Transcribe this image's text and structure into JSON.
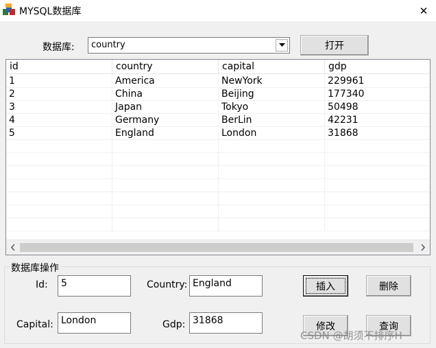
{
  "window": {
    "title": "MYSQL数据库",
    "close_glyph": "✕"
  },
  "toolbar": {
    "db_label": "数据库:",
    "db_selected": "country",
    "open_button": "打开"
  },
  "table": {
    "columns": [
      "id",
      "country",
      "capital",
      "gdp"
    ],
    "rows": [
      [
        "1",
        "America",
        "NewYork",
        "229961"
      ],
      [
        "2",
        "China",
        "Beijing",
        "177340"
      ],
      [
        "3",
        "Japan",
        "Tokyo",
        "50498"
      ],
      [
        "4",
        "Germany",
        "BerLin",
        "42231"
      ],
      [
        "5",
        "England",
        "London",
        "31868"
      ]
    ]
  },
  "form": {
    "group_title": "数据库操作",
    "id_label": "Id:",
    "id_value": "5",
    "country_label": "Country:",
    "country_value": "England",
    "capital_label": "Capital:",
    "capital_value": "London",
    "gdp_label": "Gdp:",
    "gdp_value": "31868",
    "insert_button": "插入",
    "delete_button": "删除",
    "update_button": "修改",
    "query_button": "查询"
  },
  "watermark": "CSDN @胡须不排序H",
  "icons": {
    "app": "mysql-app-icon",
    "close": "close-icon",
    "dropdown": "chevron-down-icon",
    "scroll_left": "chevron-left-icon",
    "scroll_right": "chevron-right-icon"
  }
}
